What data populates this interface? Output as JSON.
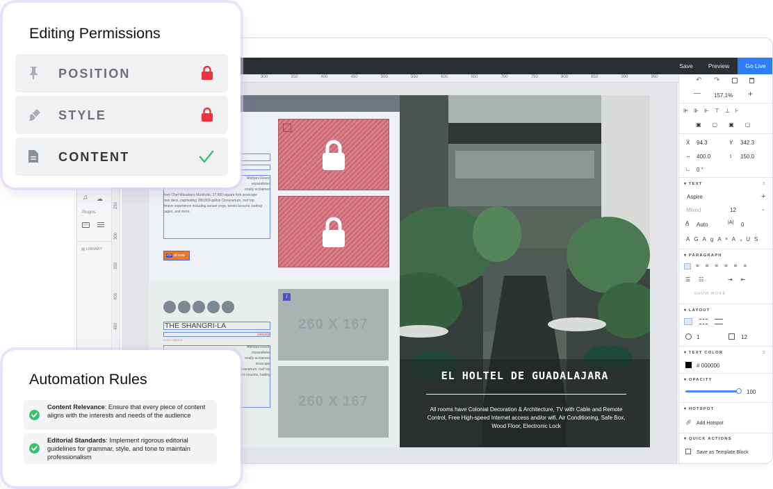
{
  "topbar": {
    "save": "Save",
    "preview": "Preview",
    "go_live": "Go Live"
  },
  "ruler": [
    "300",
    "350",
    "400",
    "450",
    "500",
    "550",
    "600",
    "650",
    "700",
    "750",
    "800",
    "850",
    "900",
    "950",
    "1000",
    "1050",
    "1100",
    "1150",
    "1200"
  ],
  "ruler_v": [
    "250",
    "300",
    "350",
    "400",
    "450",
    "500",
    "550"
  ],
  "left_panel": {
    "plugins": "Plugins",
    "library": "LIBRARY"
  },
  "canvas": {
    "hotel1_text": [
      "'Ahihlani Resort",
      "unparalleled",
      "onally acclaimed",
      "from Chef Masaharu Morimoto, 17,000 square foot seascape",
      "pool deck, captivating 280,000-gallon Oceanarium, roof top",
      "fitness experience including sunset yoga, tennis lessons, batting",
      "cages, and more."
    ],
    "book_now": "ok now",
    "hotel2_title": "THE SHANGRI-LA",
    "hotel2_small": "(555)555",
    "hotel2_addr": "Hotel Address",
    "hotel2_text": [
      "'Ahihlani Resort",
      "unparalleled",
      "onally acclaimed",
      "seascape",
      "Oceanarium, roof top",
      "tennis lessons, batting"
    ],
    "placeholder1": "260 X 167",
    "placeholder2": "260 X 167",
    "hero_title": "EL HOLTEL DE GUADALAJARA",
    "hero_desc": "All rooms have Colonial Decoration & Architecture, TV with Cable and Remote Control, Free High-speed Internet access and/or wifi, Air Conditioning, Safe Box, Wood Floor, Electronic Lock"
  },
  "right_panel": {
    "zoom": "157.1%",
    "x_label": "X",
    "x": "94.3",
    "y_label": "Y",
    "y": "342.3",
    "w": "400.0",
    "h": "150.0",
    "rot": "0 °",
    "text_section": "TEXT",
    "font": "Aspire",
    "weight": "Mixed",
    "size": "12",
    "line_height": "Auto",
    "letter_spacing": "0",
    "paragraph_section": "PARAGRAPH",
    "show_more": "SHOW MORE",
    "layout_section": "LAYOUT",
    "columns": "1",
    "grid": "12",
    "text_color_section": "TEXT COLOR",
    "color_value": "# 000000",
    "opacity_section": "OPACITY",
    "opacity": "100",
    "hotspot_section": "HOTSPOT",
    "add_hotspot": "Add Hotspot",
    "quick_actions_section": "QUICK ACTIONS",
    "save_template": "Save as Template Block"
  },
  "permissions": {
    "title": "Editing Permissions",
    "rows": [
      {
        "label": "POSITION",
        "icon": "pin-icon",
        "status": "locked"
      },
      {
        "label": "STYLE",
        "icon": "brush-icon",
        "status": "locked"
      },
      {
        "label": "CONTENT",
        "icon": "document-icon",
        "status": "allowed"
      }
    ],
    "lock_color": "#f0313b",
    "check_color": "#3cc071"
  },
  "automation": {
    "title": "Automation Rules",
    "rules": [
      {
        "bold": "Content Relevance",
        "text": ": Ensure that every piece of content aligns with the interests and needs of the audience"
      },
      {
        "bold": "Editorial Standards",
        "text": ": Implement rigorous editorial guidelines for grammar, style, and tone to maintain professionalism"
      }
    ]
  },
  "colors": {
    "accent": "#2f7df6",
    "topbar": "#2b2e33"
  }
}
